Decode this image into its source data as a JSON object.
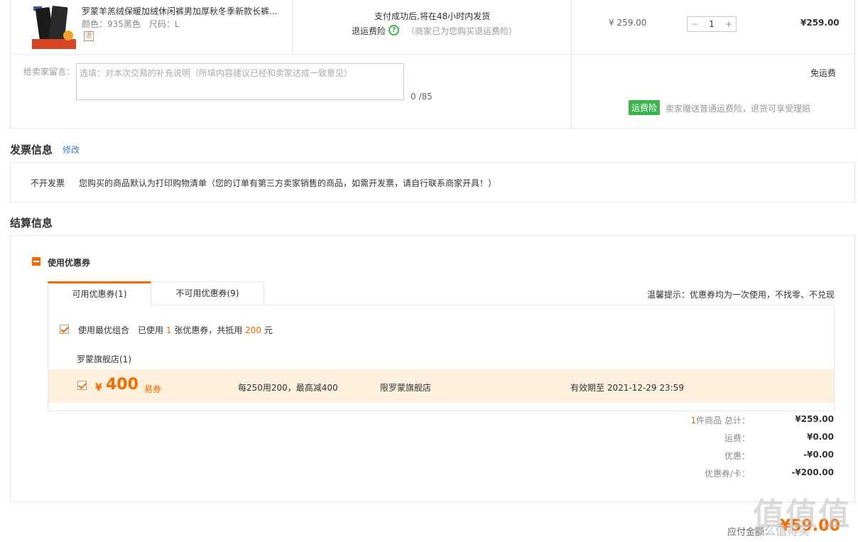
{
  "product": {
    "title": "罗蒙羊羔绒保暖加绒休闲裤男加厚秋冬季新款长裤...",
    "spec": "颜色：935黑色　尺码：L",
    "refund_badge": "退",
    "shipping_text": "支付成功后,将在48小时内发货",
    "insurance_label": "退运费险",
    "insurance_note": "（商家已为您购买退运费险）",
    "unit_price": "¥ 259.00",
    "quantity": "1",
    "minus": "−",
    "plus": "+",
    "line_total": "¥259.00"
  },
  "message": {
    "label": "给卖家留言：",
    "placeholder": "选填：对本次交易的补充说明（所填内容建议已经和卖家达成一致意见）",
    "count": "0 /85"
  },
  "delivery": {
    "free_shipping": "免运费",
    "insurance_badge": "运费险",
    "insurance_note": "卖家赠送普通运费险，退货可享受理赔"
  },
  "invoice": {
    "title": "发票信息",
    "edit": "修改",
    "type": "不开发票",
    "desc": "您购买的商品默认为打印购物清单（您的订单有第三方卖家销售的商品，如需开发票，请自行联系商家开具！）"
  },
  "settlement": {
    "title": "结算信息",
    "coupon_section": "使用优惠券",
    "tabs": [
      {
        "label": "可用优惠券(1)"
      },
      {
        "label": "不可用优惠券(9)"
      }
    ],
    "hint": "温馨提示：优惠券均为一次使用，不找零、不兑现",
    "best_combo_label": "使用最优组合",
    "best_pre": "已使用",
    "best_count": "1",
    "best_mid": "张优惠券，共抵用",
    "best_amount": "200",
    "best_post": "元",
    "store": "罗蒙旗舰店(1)",
    "coupon": {
      "yen": "¥",
      "amount": "400",
      "type": "易券",
      "rule": "每250用200，最高减400",
      "limit": "限罗蒙旗舰店",
      "expiry": "有效期至 2021-12-29 23:59"
    },
    "summary": {
      "count": "1",
      "count_label": "件商品 总计：",
      "total": "¥259.00",
      "shipping_label": "运费：",
      "shipping": "¥0.00",
      "discount_label": "优惠：",
      "discount": "-¥0.00",
      "coupon_label": "优惠券/卡：",
      "coupon": "-¥200.00"
    },
    "pay_label": "应付金额：",
    "pay_total": "¥59.00"
  },
  "watermark": {
    "main": "值值值",
    "sub": "什么值得买"
  }
}
